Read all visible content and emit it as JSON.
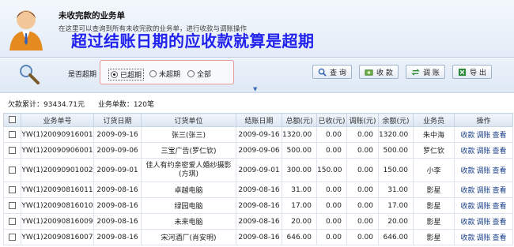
{
  "header": {
    "title": "未收完款的业务单",
    "subtitle": "在这里可以查询到所有未收完款的业务单，进行收款与调账操作",
    "overlay": "超过结账日期的应收款就算是超期"
  },
  "filter": {
    "label": "是否超期",
    "options": [
      "已超期",
      "未超期",
      "全部"
    ],
    "selected": "已超期"
  },
  "toolbar": {
    "query": "查 询",
    "collect": "收 款",
    "adjust": "调 账",
    "export": "导 出"
  },
  "summary": {
    "owed": "欠款累计：93434.71元",
    "count": "业务单数：120笔"
  },
  "table": {
    "headers": [
      "业务单号",
      "订货日期",
      "订货单位",
      "结账日期",
      "总额(元)",
      "已收(元)",
      "调账(元)",
      "余额(元)",
      "业务员",
      "操作"
    ],
    "actions": [
      "收款",
      "调账",
      "查看"
    ],
    "rows": [
      [
        "YW(1)20090916001",
        "2009-09-16",
        "张三(张三)",
        "2009-09-16",
        "1320.00",
        "0.00",
        "0.00",
        "1320.00",
        "朱中海"
      ],
      [
        "YW(1)20090906001",
        "2009-09-06",
        "三宝广告(罗仁钦)",
        "2009-09-06",
        "500.00",
        "0.00",
        "0.00",
        "500.00",
        "罗仁钦"
      ],
      [
        "YW(1)20090901002",
        "2009-09-01",
        "佳人有约亲密爱人婚纱摄影(方琪)",
        "2009-09-01",
        "300.00",
        "150.00",
        "0.00",
        "150.00",
        "小李"
      ],
      [
        "YW(1)20090816011",
        "2009-08-16",
        "卓越电脑",
        "2009-08-16",
        "31.00",
        "0.00",
        "0.00",
        "31.00",
        "影星"
      ],
      [
        "YW(1)20090816010",
        "2009-08-16",
        "绿园电脑",
        "2009-08-16",
        "17.00",
        "0.00",
        "0.00",
        "17.00",
        "影星"
      ],
      [
        "YW(1)20090816009",
        "2009-08-16",
        "未来电脑",
        "2009-08-16",
        "20.00",
        "0.00",
        "0.00",
        "20.00",
        "影星"
      ],
      [
        "YW(1)20090816007",
        "2009-08-16",
        "宋河酒厂(肖安明)",
        "2009-08-16",
        "646.00",
        "0.00",
        "0.00",
        "646.00",
        "影星"
      ]
    ]
  }
}
